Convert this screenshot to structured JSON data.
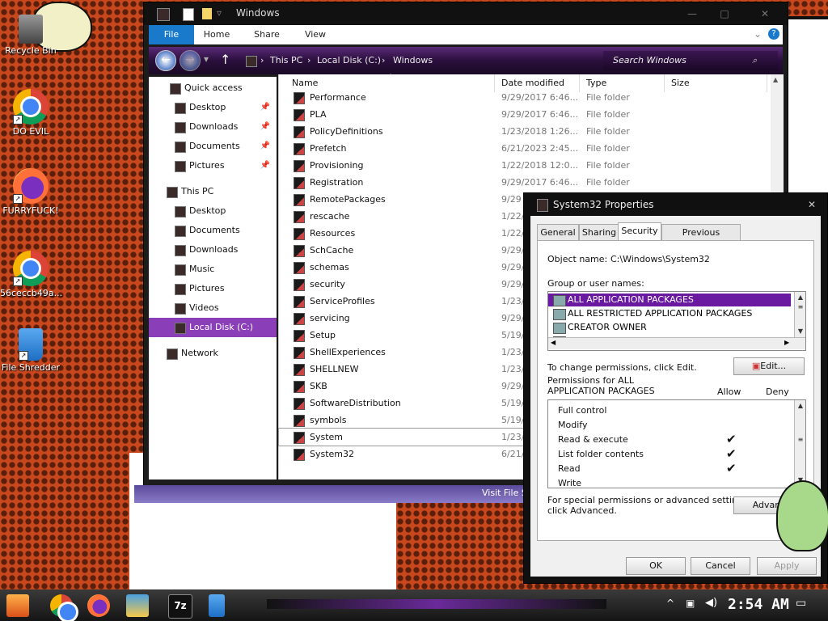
{
  "desktop": {
    "icons": [
      {
        "label": "Recycle Bin",
        "icon": "recycle-bin-icon"
      },
      {
        "label": "DO EVIL",
        "icon": "chrome-icon"
      },
      {
        "label": "FURRYFUCK!",
        "icon": "firefox-icon"
      },
      {
        "label": "56ceccb49a...",
        "icon": "chrome-icon"
      },
      {
        "label": "File Shredder",
        "icon": "shredder-icon"
      }
    ]
  },
  "explorer": {
    "title": "Windows",
    "ribbon_tabs": [
      "File",
      "Home",
      "Share",
      "View"
    ],
    "address": {
      "segments": [
        "This PC",
        "Local Disk (C:)",
        "Windows"
      ]
    },
    "search_placeholder": "Search Windows",
    "nav": [
      {
        "label": "Quick access",
        "pinned": false
      },
      {
        "label": "Desktop",
        "pinned": true
      },
      {
        "label": "Downloads",
        "pinned": true
      },
      {
        "label": "Documents",
        "pinned": true
      },
      {
        "label": "Pictures",
        "pinned": true
      },
      {
        "label": "This PC",
        "pinned": false
      },
      {
        "label": "Desktop",
        "pinned": false
      },
      {
        "label": "Documents",
        "pinned": false
      },
      {
        "label": "Downloads",
        "pinned": false
      },
      {
        "label": "Music",
        "pinned": false
      },
      {
        "label": "Pictures",
        "pinned": false
      },
      {
        "label": "Videos",
        "pinned": false
      },
      {
        "label": "Local Disk (C:)",
        "pinned": false,
        "selected": true
      },
      {
        "label": "Network",
        "pinned": false
      }
    ],
    "columns": [
      "Name",
      "Date modified",
      "Type",
      "Size"
    ],
    "files": [
      {
        "name": "Performance",
        "date": "9/29/2017 6:46...",
        "type": "File folder"
      },
      {
        "name": "PLA",
        "date": "9/29/2017 6:46...",
        "type": "File folder"
      },
      {
        "name": "PolicyDefinitions",
        "date": "1/23/2018 1:26...",
        "type": "File folder"
      },
      {
        "name": "Prefetch",
        "date": "6/21/2023 2:45...",
        "type": "File folder"
      },
      {
        "name": "Provisioning",
        "date": "1/22/2018 12:0...",
        "type": "File folder"
      },
      {
        "name": "Registration",
        "date": "9/29/2017 6:46...",
        "type": "File folder"
      },
      {
        "name": "RemotePackages",
        "date": "9/29",
        "type": ""
      },
      {
        "name": "rescache",
        "date": "1/22/",
        "type": ""
      },
      {
        "name": "Resources",
        "date": "1/22/",
        "type": ""
      },
      {
        "name": "SchCache",
        "date": "9/29/",
        "type": ""
      },
      {
        "name": "schemas",
        "date": "9/29/",
        "type": ""
      },
      {
        "name": "security",
        "date": "9/29/",
        "type": ""
      },
      {
        "name": "ServiceProfiles",
        "date": "1/23/",
        "type": ""
      },
      {
        "name": "servicing",
        "date": "9/29/",
        "type": ""
      },
      {
        "name": "Setup",
        "date": "5/19/",
        "type": ""
      },
      {
        "name": "ShellExperiences",
        "date": "1/23/",
        "type": ""
      },
      {
        "name": "SHELLNEW",
        "date": "1/23/",
        "type": ""
      },
      {
        "name": "SKB",
        "date": "9/29/",
        "type": ""
      },
      {
        "name": "SoftwareDistribution",
        "date": "5/19/",
        "type": ""
      },
      {
        "name": "symbols",
        "date": "5/19/",
        "type": ""
      },
      {
        "name": "System",
        "date": "1/23/",
        "type": "",
        "selected": true
      },
      {
        "name": "System32",
        "date": "6/21/",
        "type": ""
      }
    ],
    "status": "Visit File Sh"
  },
  "properties": {
    "title": "System32 Properties",
    "tabs": [
      "General",
      "Sharing",
      "Security",
      "Previous Versions"
    ],
    "active_tab": "Security",
    "object_name_label": "Object name:",
    "object_name": "C:\\Windows\\System32",
    "group_label": "Group or user names:",
    "groups": [
      "ALL APPLICATION PACKAGES",
      "ALL RESTRICTED APPLICATION PACKAGES",
      "CREATOR OWNER",
      "SYSTEM"
    ],
    "change_text": "To change permissions, click Edit.",
    "edit_label": "Edit...",
    "perm_label": "Permissions for ALL APPLICATION PACKAGES",
    "allow_label": "Allow",
    "deny_label": "Deny",
    "permissions": [
      {
        "name": "Full control",
        "allow": false
      },
      {
        "name": "Modify",
        "allow": false
      },
      {
        "name": "Read & execute",
        "allow": true
      },
      {
        "name": "List folder contents",
        "allow": true
      },
      {
        "name": "Read",
        "allow": true
      },
      {
        "name": "Write",
        "allow": false
      }
    ],
    "check_glyph": "✔",
    "special_text_1": "For special permissions or advanced settings,",
    "special_text_2": "click Advanced.",
    "advanced_label": "Advanc",
    "ok": "OK",
    "cancel": "Cancel",
    "apply": "Apply"
  },
  "taskbar": {
    "clock": "2:54 AM",
    "apps": [
      "start-icon",
      "chrome-icon",
      "firefox-icon",
      "file-explorer-icon",
      "7zip-icon",
      "shredder-icon"
    ],
    "seven_zip_label": "7z"
  }
}
